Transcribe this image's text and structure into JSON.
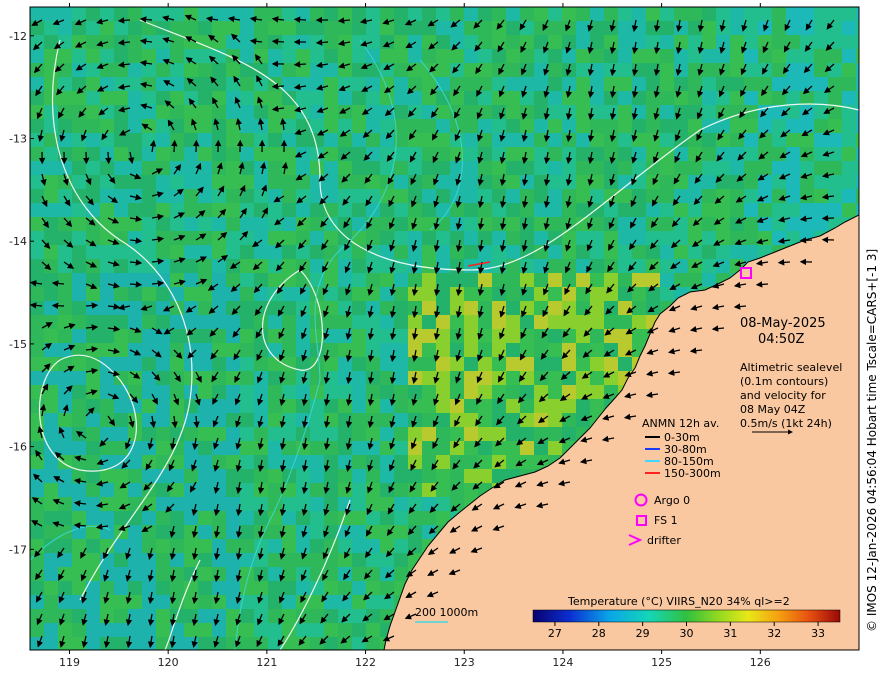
{
  "map": {
    "x_ticks": [
      "119",
      "120",
      "121",
      "122",
      "123",
      "124",
      "125",
      "126"
    ],
    "y_ticks": [
      "-12",
      "-13",
      "-14",
      "-15",
      "-16",
      "-17"
    ],
    "lon_range": [
      118.6,
      127.0
    ],
    "lat_range": [
      -17.98,
      -11.72
    ]
  },
  "date_block": {
    "date": "08-May-2025",
    "time": "04:50Z"
  },
  "altimetry_note": {
    "lines": [
      "Altimetric sealevel",
      "(0.1m contours)",
      "and velocity for",
      "08 May 04Z",
      "0.5m/s (1kt 24h)"
    ]
  },
  "anmn_legend": {
    "title": "ANMN 12h av.",
    "items": [
      {
        "label": "0-30m",
        "color": "#000000"
      },
      {
        "label": "30-80m",
        "color": "#1a3cff"
      },
      {
        "label": "80-150m",
        "color": "#40d8ff"
      },
      {
        "label": "150-300m",
        "color": "#ff2020"
      }
    ]
  },
  "platform_legend": {
    "argo": "Argo 0",
    "fs": "FS 1",
    "drifter": "drifter",
    "symbol_color": "#ff00ff"
  },
  "bathy_legend": {
    "label": "200  1000m",
    "color": "#40d8e0"
  },
  "colorbar": {
    "title": "Temperature (°C) VIIRS_N20 34% ql>=2",
    "ticks": [
      "27",
      "28",
      "29",
      "30",
      "31",
      "32",
      "33"
    ],
    "range": [
      26.5,
      33.5
    ]
  },
  "credit": "© IMOS 12-Jan-2026 04:56:04 Hobart time Tscale=CARS+[-1 3]",
  "colors": {
    "land": "#f9c8a0",
    "coast": "#000000",
    "sea_level_contour": "#ffffff",
    "bathy_contour": "#40d8e0",
    "fs_marker": "#ff00ff"
  }
}
